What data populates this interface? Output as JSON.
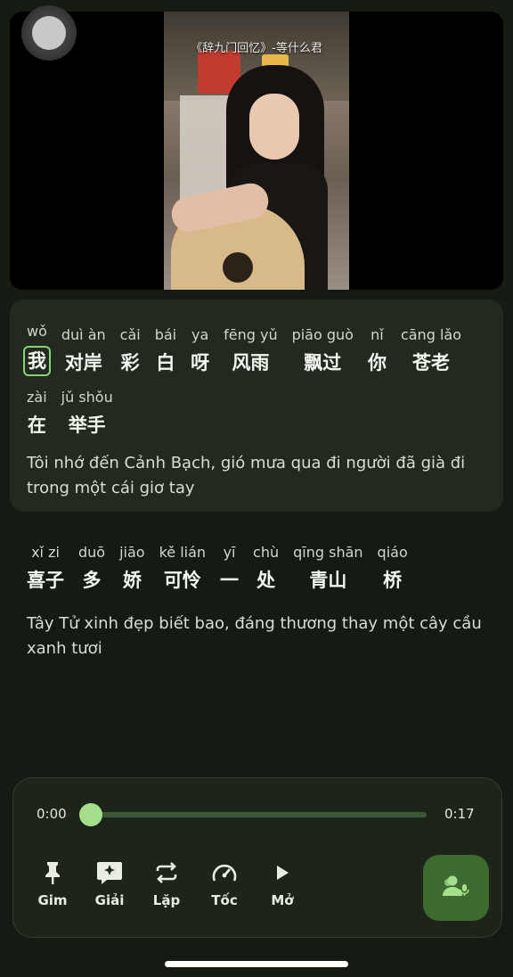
{
  "video": {
    "title": "《辞九门回忆》-等什么君"
  },
  "lyrics": {
    "current": {
      "line1": [
        {
          "pinyin": "wǒ",
          "hanzi": "我",
          "active": true
        },
        {
          "pinyin": "duì àn",
          "hanzi": "对岸"
        },
        {
          "pinyin": "cǎi",
          "hanzi": "彩"
        },
        {
          "pinyin": "bái",
          "hanzi": "白"
        },
        {
          "pinyin": "ya",
          "hanzi": "呀"
        },
        {
          "pinyin": "fēng yǔ",
          "hanzi": "风雨"
        },
        {
          "pinyin": "piāo guò",
          "hanzi": "飘过"
        },
        {
          "pinyin": "nǐ",
          "hanzi": "你"
        },
        {
          "pinyin": "cāng lǎo",
          "hanzi": "苍老"
        }
      ],
      "line2": [
        {
          "pinyin": "zài",
          "hanzi": "在"
        },
        {
          "pinyin": "jǔ shǒu",
          "hanzi": "举手"
        }
      ],
      "translation": "Tôi nhớ đến Cảnh Bạch, gió mưa qua đi người đã già đi trong một cái giơ tay"
    },
    "next": {
      "line1": [
        {
          "pinyin": "xǐ zi",
          "hanzi": "喜子"
        },
        {
          "pinyin": "duō",
          "hanzi": "多"
        },
        {
          "pinyin": "jiāo",
          "hanzi": "娇"
        },
        {
          "pinyin": "kě lián",
          "hanzi": "可怜"
        },
        {
          "pinyin": "yī",
          "hanzi": "一"
        },
        {
          "pinyin": "chù",
          "hanzi": "处"
        },
        {
          "pinyin": "qīng shān",
          "hanzi": "青山"
        },
        {
          "pinyin": "qiáo",
          "hanzi": "桥"
        }
      ],
      "translation": "Tây Tử xinh đẹp biết bao, đáng thương thay một cây cầu xanh tươi"
    }
  },
  "player": {
    "current_time": "0:00",
    "total_time": "0:17",
    "progress": 0,
    "controls": [
      {
        "label": "Gim",
        "icon": "pin-icon"
      },
      {
        "label": "Giải",
        "icon": "sparkle-icon"
      },
      {
        "label": "Lặp",
        "icon": "repeat-icon"
      },
      {
        "label": "Tốc",
        "icon": "speed-icon"
      },
      {
        "label": "Mở",
        "icon": "play-icon"
      }
    ],
    "fab_icon": "voice-user-icon"
  },
  "colors": {
    "background": "#151a13",
    "card": "#222a1f",
    "accent": "#a4e08c",
    "fab": "#3e6a30"
  }
}
